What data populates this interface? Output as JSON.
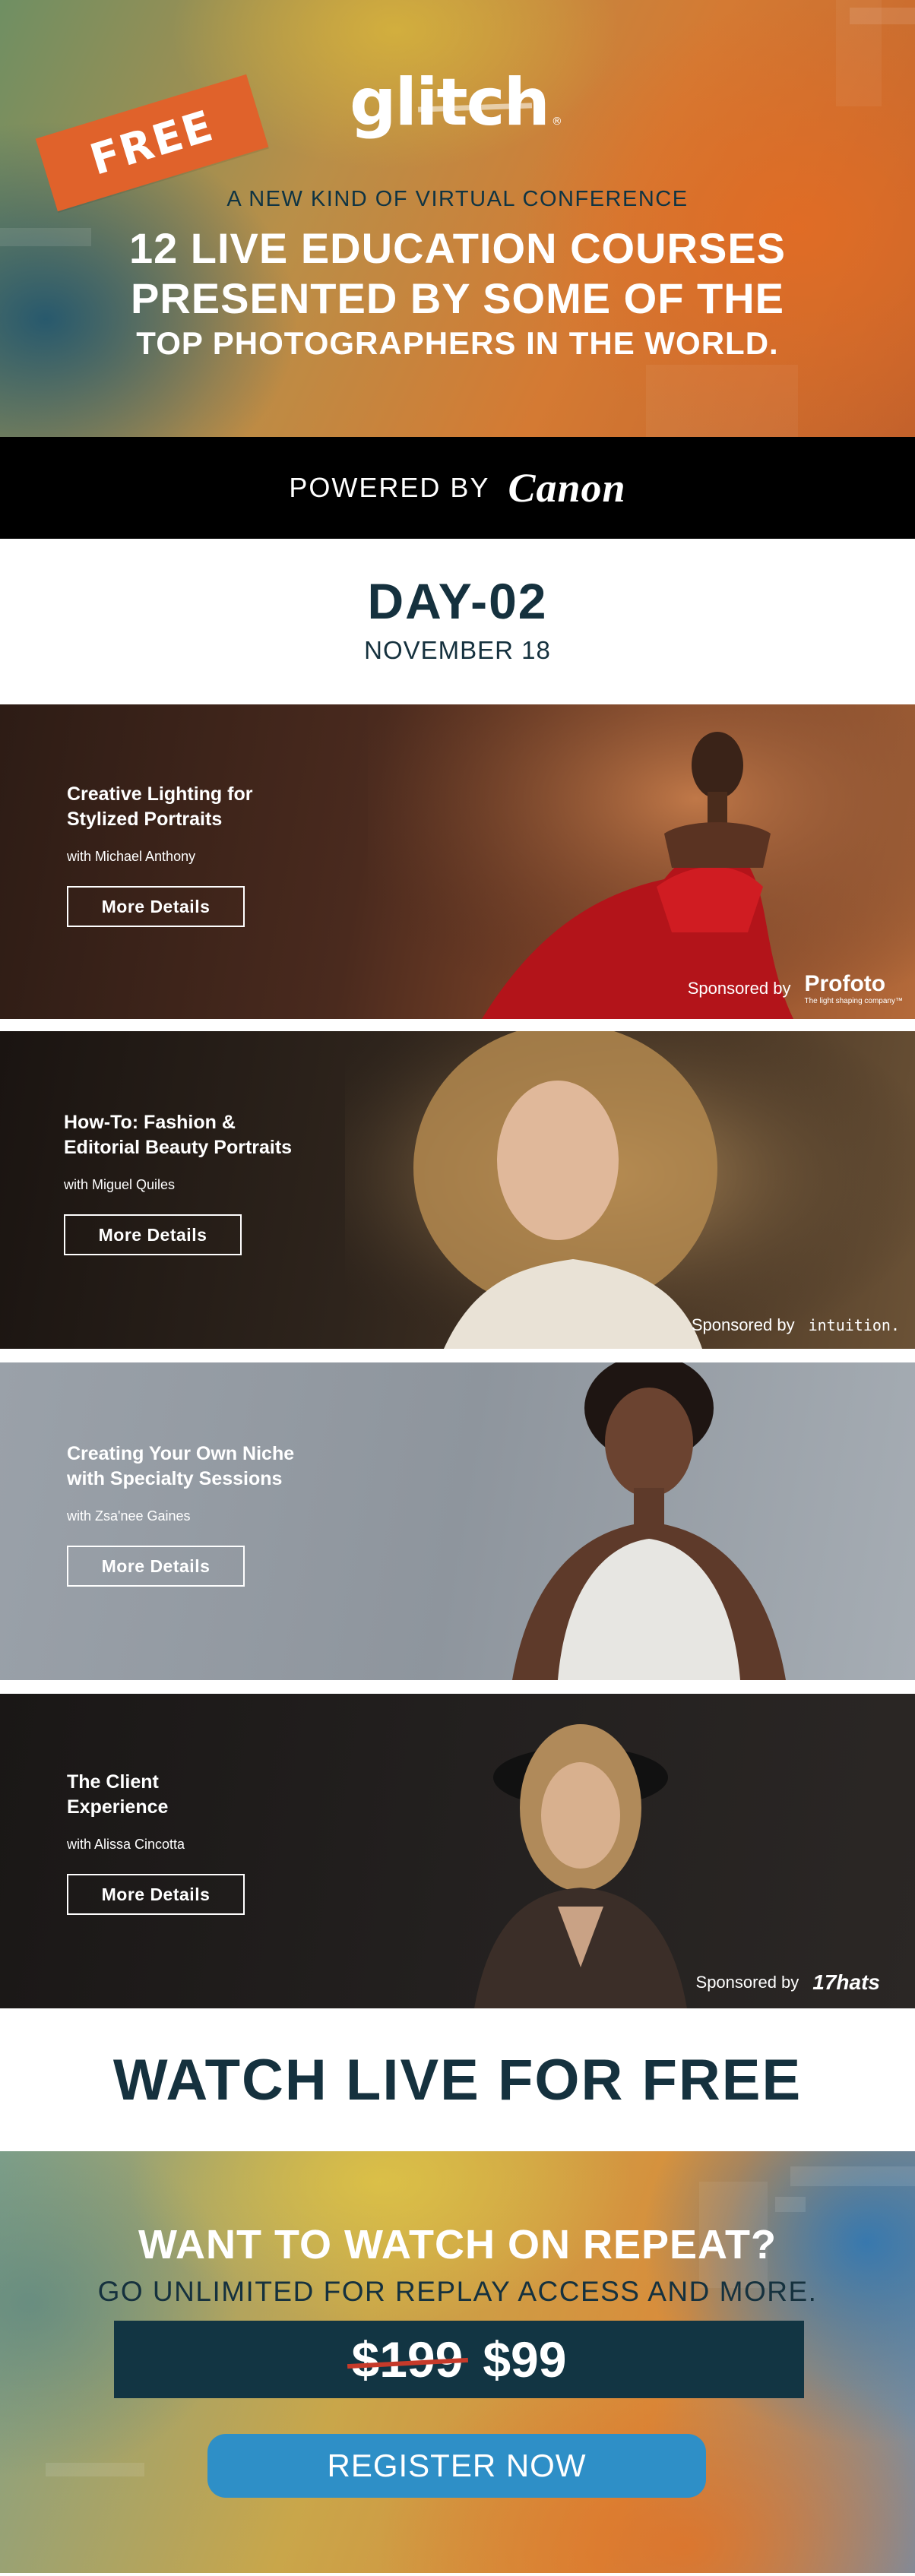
{
  "hero": {
    "badge": "FREE",
    "logo": "glitch",
    "logo_mark": "®",
    "kicker": "A NEW KIND OF VIRTUAL CONFERENCE",
    "headline_1": "12 LIVE EDUCATION COURSES",
    "headline_2": "PRESENTED BY SOME OF THE",
    "headline_3": "TOP PHOTOGRAPHERS IN THE WORLD."
  },
  "powered": {
    "label": "POWERED BY",
    "brand": "Canon"
  },
  "day": {
    "title": "DAY-02",
    "date": "NOVEMBER 18"
  },
  "courses": [
    {
      "title_1": "Creative Lighting for",
      "title_2": "Stylized Portraits",
      "with": "with Michael Anthony",
      "button": "More Details",
      "sponsored_by": "Sponsored by",
      "sponsor": "Profoto",
      "sponsor_tagline": "The light shaping company™"
    },
    {
      "title_1": "How-To: Fashion &",
      "title_2": "Editorial Beauty Portraits",
      "with": "with Miguel Quiles",
      "button": "More Details",
      "sponsored_by": "Sponsored by",
      "sponsor": "intuition."
    },
    {
      "title_1": "Creating Your Own Niche",
      "title_2": "with Specialty Sessions",
      "with": "with Zsa'nee Gaines",
      "button": "More Details"
    },
    {
      "title_1": "The Client",
      "title_2": "Experience",
      "with": "with Alissa Cincotta",
      "button": "More Details",
      "sponsored_by": "Sponsored by",
      "sponsor": "17hats"
    }
  ],
  "watch": {
    "label": "WATCH LIVE FOR FREE"
  },
  "promo": {
    "question": "WANT TO WATCH ON REPEAT?",
    "subline": "GO UNLIMITED FOR REPLAY ACCESS AND MORE.",
    "old_price": "$199",
    "new_price": "$99",
    "cta": "REGISTER NOW"
  },
  "colors": {
    "navy": "#15313e",
    "price_box": "#123543",
    "cta_blue": "#2e8fc7",
    "badge_orange": "#e0622b"
  }
}
